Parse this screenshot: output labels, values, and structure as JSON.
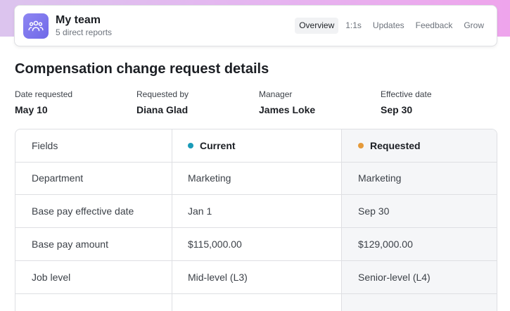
{
  "header": {
    "title": "My team",
    "subtitle": "5 direct reports",
    "icon": "team-icon",
    "tabs": [
      {
        "label": "Overview",
        "active": true
      },
      {
        "label": "1:1s",
        "active": false
      },
      {
        "label": "Updates",
        "active": false
      },
      {
        "label": "Feedback",
        "active": false
      },
      {
        "label": "Grow",
        "active": false
      }
    ]
  },
  "page": {
    "title": "Compensation change request details"
  },
  "meta": [
    {
      "label": "Date requested",
      "value": "May 10"
    },
    {
      "label": "Requested by",
      "value": "Diana Glad"
    },
    {
      "label": "Manager",
      "value": "James Loke"
    },
    {
      "label": "Effective date",
      "value": "Sep 30"
    }
  ],
  "table": {
    "headers": {
      "fields": "Fields",
      "current": "Current",
      "requested": "Requested"
    },
    "colors": {
      "current_dot": "#1a9bb8",
      "requested_dot": "#e59a3a"
    },
    "rows": [
      {
        "field": "Department",
        "current": "Marketing",
        "requested": "Marketing"
      },
      {
        "field": "Base pay effective date",
        "current": "Jan 1",
        "requested": "Sep 30"
      },
      {
        "field": "Base pay amount",
        "current": "$115,000.00",
        "requested": "$129,000.00"
      },
      {
        "field": "Job level",
        "current": "Mid-level (L3)",
        "requested": "Senior-level (L4)"
      }
    ]
  }
}
